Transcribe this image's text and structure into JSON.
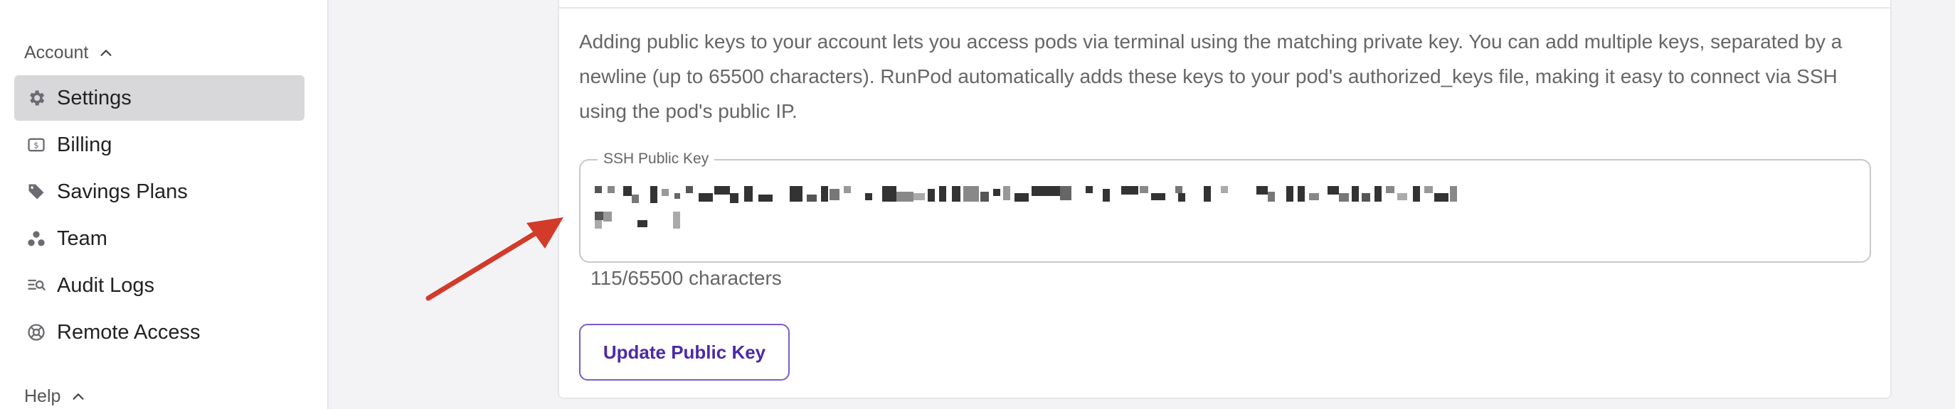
{
  "sidebar": {
    "account_heading": "Account",
    "help_heading": "Help",
    "items": [
      {
        "label": "Settings",
        "icon": "gear-icon",
        "active": true
      },
      {
        "label": "Billing",
        "icon": "billing-icon"
      },
      {
        "label": "Savings Plans",
        "icon": "tag-icon"
      },
      {
        "label": "Team",
        "icon": "team-icon"
      },
      {
        "label": "Audit Logs",
        "icon": "audit-logs-icon"
      },
      {
        "label": "Remote Access",
        "icon": "remote-access-icon"
      }
    ]
  },
  "ssh": {
    "description": "Adding public keys to your account lets you access pods via terminal using the matching private key. You can add multiple keys, separated by a newline (up to 65500 characters). RunPod automatically adds these keys to your pod's authorized_keys file, making it easy to connect via SSH using the pod's public IP.",
    "field_label": "SSH Public Key",
    "char_count": "115/65500 characters",
    "update_button": "Update Public Key"
  },
  "colors": {
    "accent": "#4b2aa6",
    "active_nav_bg": "#d8d8db",
    "annotation_arrow": "#d23a2a"
  }
}
